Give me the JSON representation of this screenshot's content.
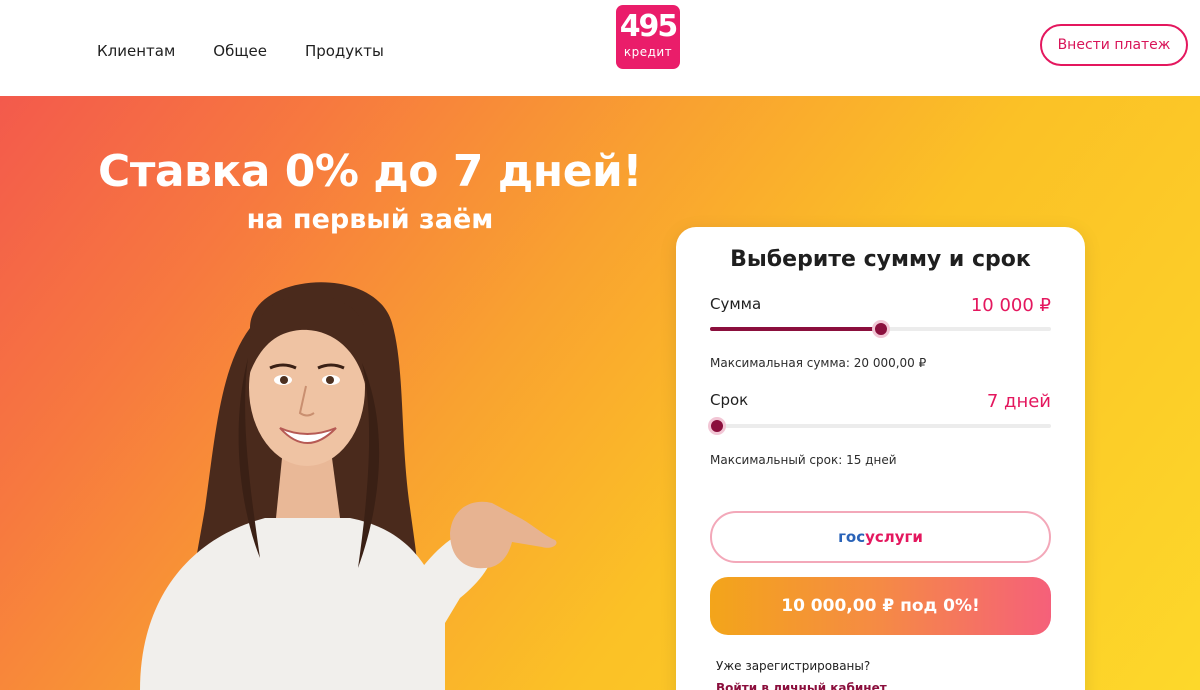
{
  "header": {
    "nav": [
      "Клиентам",
      "Общее",
      "Продукты"
    ],
    "logo": {
      "number": "495",
      "word": "кредит"
    },
    "pay_button": "Внести платеж"
  },
  "hero": {
    "title": "Ставка 0% до 7 дней!",
    "subtitle": "на первый заём"
  },
  "calculator": {
    "title": "Выберите сумму и срок",
    "amount": {
      "label": "Сумма",
      "value": "10 000 ₽",
      "max_text": "Максимальная сумма: 20 000,00 ₽",
      "position_percent": 50
    },
    "term": {
      "label": "Срок",
      "value": "7 дней",
      "max_text": "Максимальный срок: 15 дней",
      "position_percent": 2
    },
    "gosuslugi": {
      "part1": "гос",
      "part2": "услуги"
    },
    "cta": "10 000,00 ₽ под 0%!",
    "registered_question": "Уже зарегистрированы?",
    "login_link": "Войти в личный кабинет"
  },
  "colors": {
    "brand": "#ea1d6a",
    "slider": "#8b0f3d",
    "value_text": "#e4175e"
  }
}
